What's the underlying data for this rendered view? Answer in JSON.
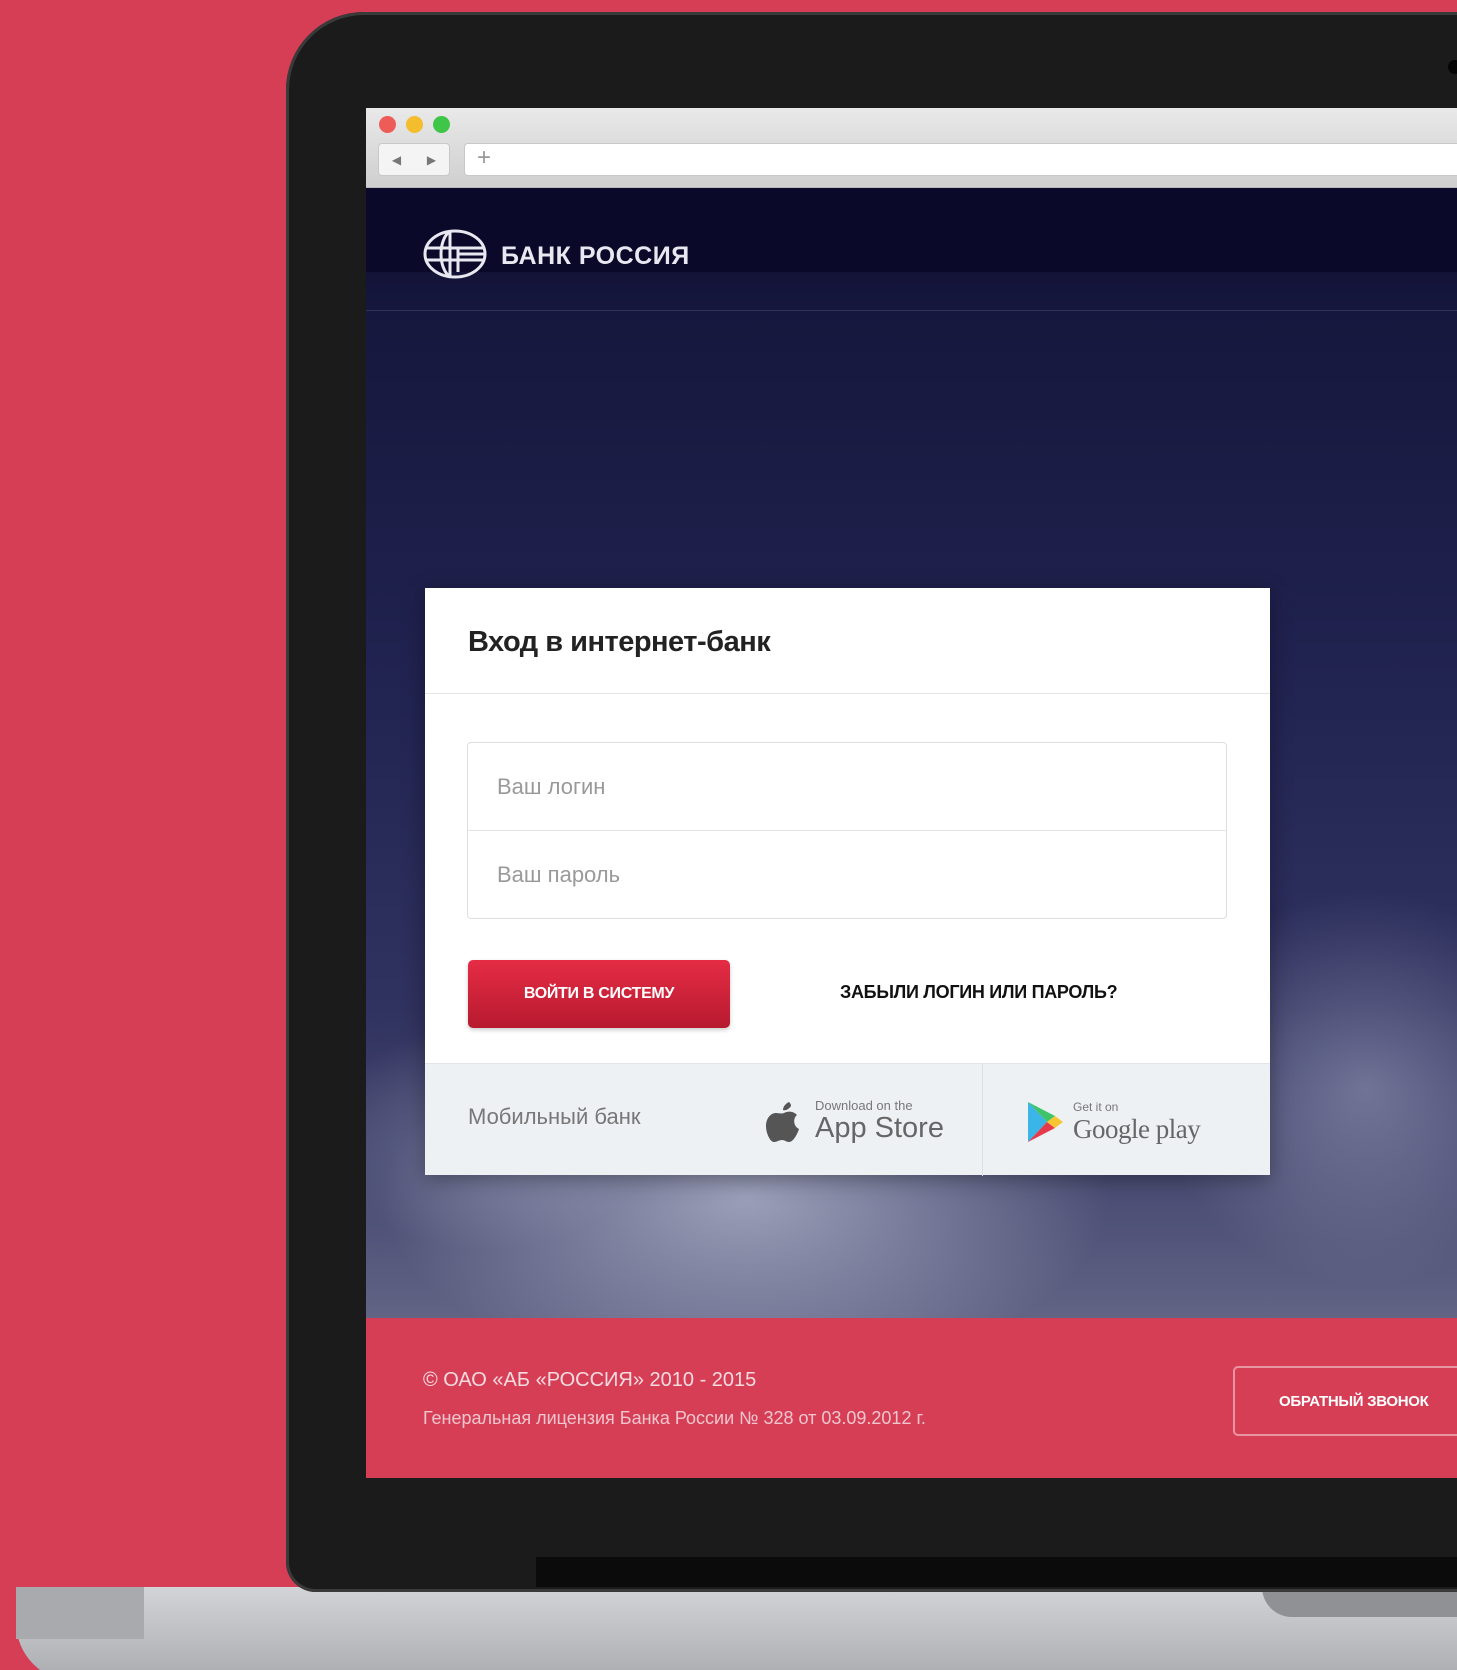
{
  "browser": {
    "nav_back": "◀",
    "nav_forward": "▶",
    "new_tab": "+"
  },
  "header": {
    "logo_text": "БАНК РОССИЯ",
    "logo_icon": "globe-icon"
  },
  "login": {
    "title": "Вход в интернет-банк",
    "login_placeholder": "Ваш логин",
    "password_placeholder": "Ваш пароль",
    "submit_label": "войти в систему",
    "forgot_label": "ЗАБЫЛИ ЛОГИН ИЛИ ПАРОЛЬ?"
  },
  "mobile": {
    "label": "Мобильный банк",
    "appstore_small": "Download on the",
    "appstore_big": "App Store",
    "googleplay_small": "Get it on",
    "googleplay_big": "Google play"
  },
  "footer": {
    "copyright": "© ОАО «АБ «РОССИЯ» 2010 - 2015",
    "license": "Генеральная лицензия Банка России № 328 от 03.09.2012 г.",
    "callback_label": "ОБРАТНЫЙ ЗВОНОК"
  },
  "colors": {
    "brand_red": "#d63e56",
    "button_red": "#d42237",
    "header_navy": "#0b0929"
  }
}
